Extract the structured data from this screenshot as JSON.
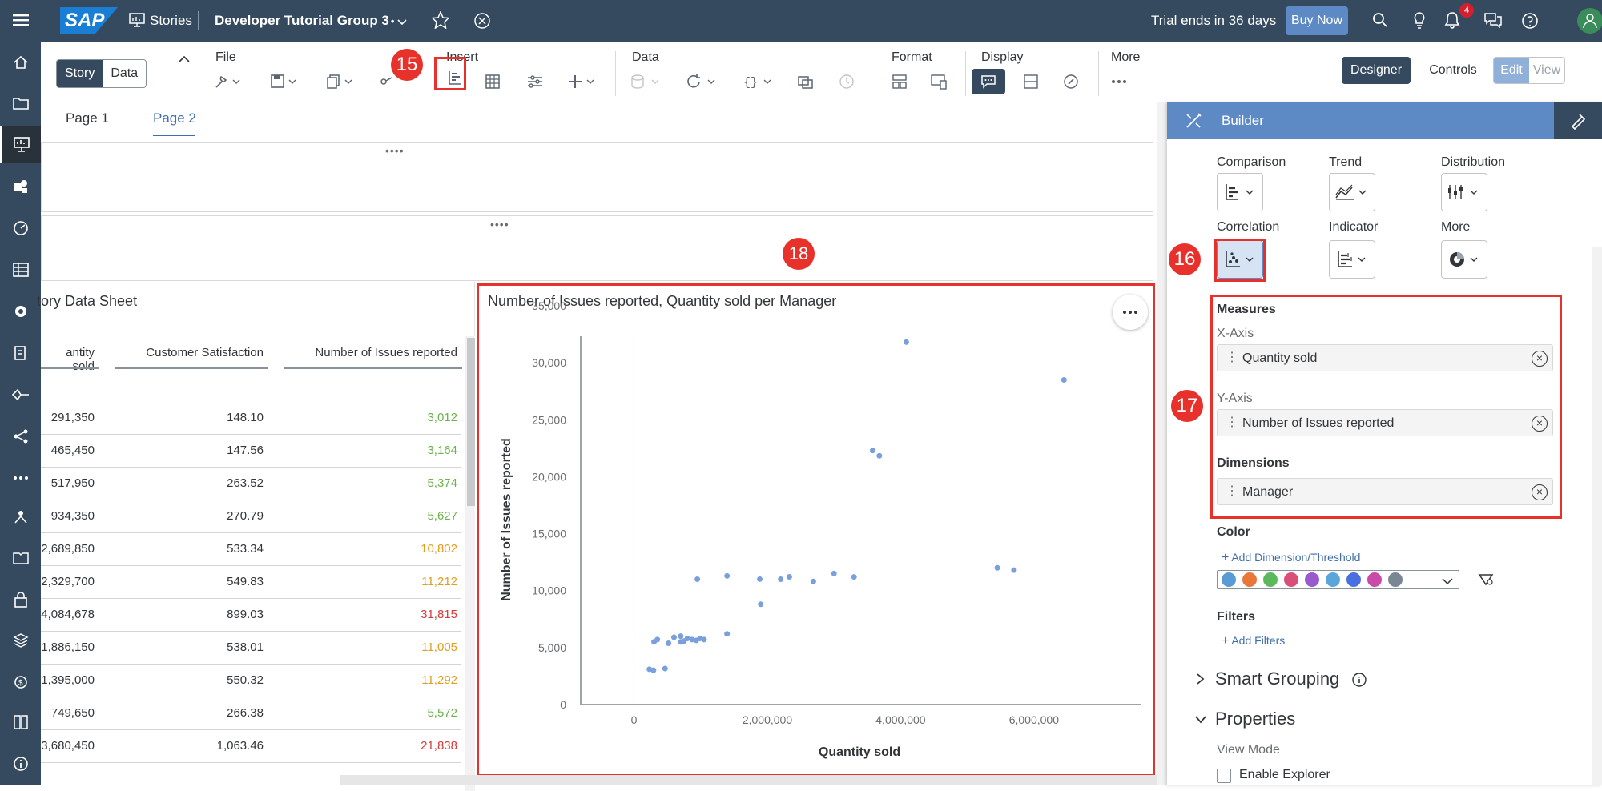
{
  "shell": {
    "logo": "SAP",
    "stories_label": "Stories",
    "story_title": "Developer Tutorial Group 3",
    "title_modified_mark": "•",
    "trial_text": "Trial ends in 36 days",
    "buy_now": "Buy Now",
    "notification_count": "4"
  },
  "toolbar": {
    "story_tab": "Story",
    "data_tab": "Data",
    "groups": {
      "file": "File",
      "insert": "Insert",
      "data": "Data",
      "format": "Format",
      "display": "Display",
      "more": "More"
    },
    "designer": "Designer",
    "controls": "Controls",
    "edit": "Edit",
    "view": "View"
  },
  "pages": {
    "page1": "Page 1",
    "page2": "Page 2"
  },
  "markers": {
    "m15": "15",
    "m16": "16",
    "m17": "17",
    "m18": "18"
  },
  "table": {
    "title": "tory Data Sheet",
    "columns": [
      "antity sold",
      "Customer Satisfaction",
      "Number of Issues reported"
    ],
    "rows": [
      [
        "291,350",
        "148.10",
        "3,012"
      ],
      [
        "465,450",
        "147.56",
        "3,164"
      ],
      [
        "517,950",
        "263.52",
        "5,374"
      ],
      [
        "934,350",
        "270.79",
        "5,627"
      ],
      [
        "2,689,850",
        "533.34",
        "10,802"
      ],
      [
        "2,329,700",
        "549.83",
        "11,212"
      ],
      [
        "4,084,678",
        "899.03",
        "31,815"
      ],
      [
        "1,886,150",
        "538.01",
        "11,005"
      ],
      [
        "1,395,000",
        "550.32",
        "11,292"
      ],
      [
        "749,650",
        "266.38",
        "5,572"
      ],
      [
        "3,680,450",
        "1,063.46",
        "21,838"
      ]
    ],
    "issue_colors": [
      "#6bb34a",
      "#6bb34a",
      "#6bb34a",
      "#6bb34a",
      "#e09e1e",
      "#e09e1e",
      "#d93a3a",
      "#e09e1e",
      "#e09e1e",
      "#6bb34a",
      "#d93a3a"
    ]
  },
  "chart_data": {
    "type": "scatter",
    "title": "Number of Issues reported, Quantity sold per Manager",
    "xlabel": "Quantity sold",
    "ylabel": "Number of Issues reported",
    "xlim": [
      -800000,
      7600000
    ],
    "ylim": [
      0,
      35000
    ],
    "xticks": [
      "0",
      "2,000,000",
      "4,000,000",
      "6,000,000"
    ],
    "xtick_values": [
      0,
      2000000,
      4000000,
      6000000
    ],
    "yticks": [
      "0",
      "5,000",
      "10,000",
      "15,000",
      "20,000",
      "25,000",
      "30,000",
      "35,000"
    ],
    "ytick_values": [
      0,
      5000,
      10000,
      15000,
      20000,
      25000,
      30000,
      35000
    ],
    "point_color": "#7aa0dc",
    "points": [
      [
        291350,
        3012
      ],
      [
        230000,
        3100
      ],
      [
        465450,
        3164
      ],
      [
        300000,
        5500
      ],
      [
        350000,
        5700
      ],
      [
        517950,
        5374
      ],
      [
        600000,
        5900
      ],
      [
        700000,
        5500
      ],
      [
        749650,
        5572
      ],
      [
        800000,
        5800
      ],
      [
        870000,
        5700
      ],
      [
        934350,
        5627
      ],
      [
        990000,
        5800
      ],
      [
        1050000,
        5700
      ],
      [
        700000,
        6000
      ],
      [
        1395000,
        6200
      ],
      [
        950000,
        11000
      ],
      [
        1395000,
        11292
      ],
      [
        1886150,
        11005
      ],
      [
        1900000,
        8800
      ],
      [
        2200000,
        11000
      ],
      [
        2329700,
        11212
      ],
      [
        2689850,
        10802
      ],
      [
        3000000,
        11500
      ],
      [
        3300000,
        11200
      ],
      [
        3580000,
        22300
      ],
      [
        3680450,
        21838
      ],
      [
        4084678,
        31815
      ],
      [
        5450000,
        12000
      ],
      [
        5700000,
        11800
      ],
      [
        6450000,
        28500
      ]
    ]
  },
  "builder": {
    "title": "Builder",
    "categories": [
      "Comparison",
      "Trend",
      "Distribution",
      "Correlation",
      "Indicator",
      "More"
    ],
    "measures_label": "Measures",
    "x_axis_label": "X-Axis",
    "x_axis_value": "Quantity sold",
    "y_axis_label": "Y-Axis",
    "y_axis_value": "Number of Issues reported",
    "dimensions_label": "Dimensions",
    "dimension_value": "Manager",
    "color_label": "Color",
    "add_dimension": "Add Dimension/Threshold",
    "palette": [
      "#5b9bd5",
      "#e8783a",
      "#5cb85c",
      "#d94f7a",
      "#9b59d0",
      "#5aa6d8",
      "#4a6fe0",
      "#c94aa8",
      "#7a8792"
    ],
    "filters_label": "Filters",
    "add_filters": "Add Filters",
    "smart_grouping": "Smart Grouping",
    "properties": "Properties",
    "view_mode": "View Mode",
    "enable_explorer": "Enable Explorer"
  }
}
